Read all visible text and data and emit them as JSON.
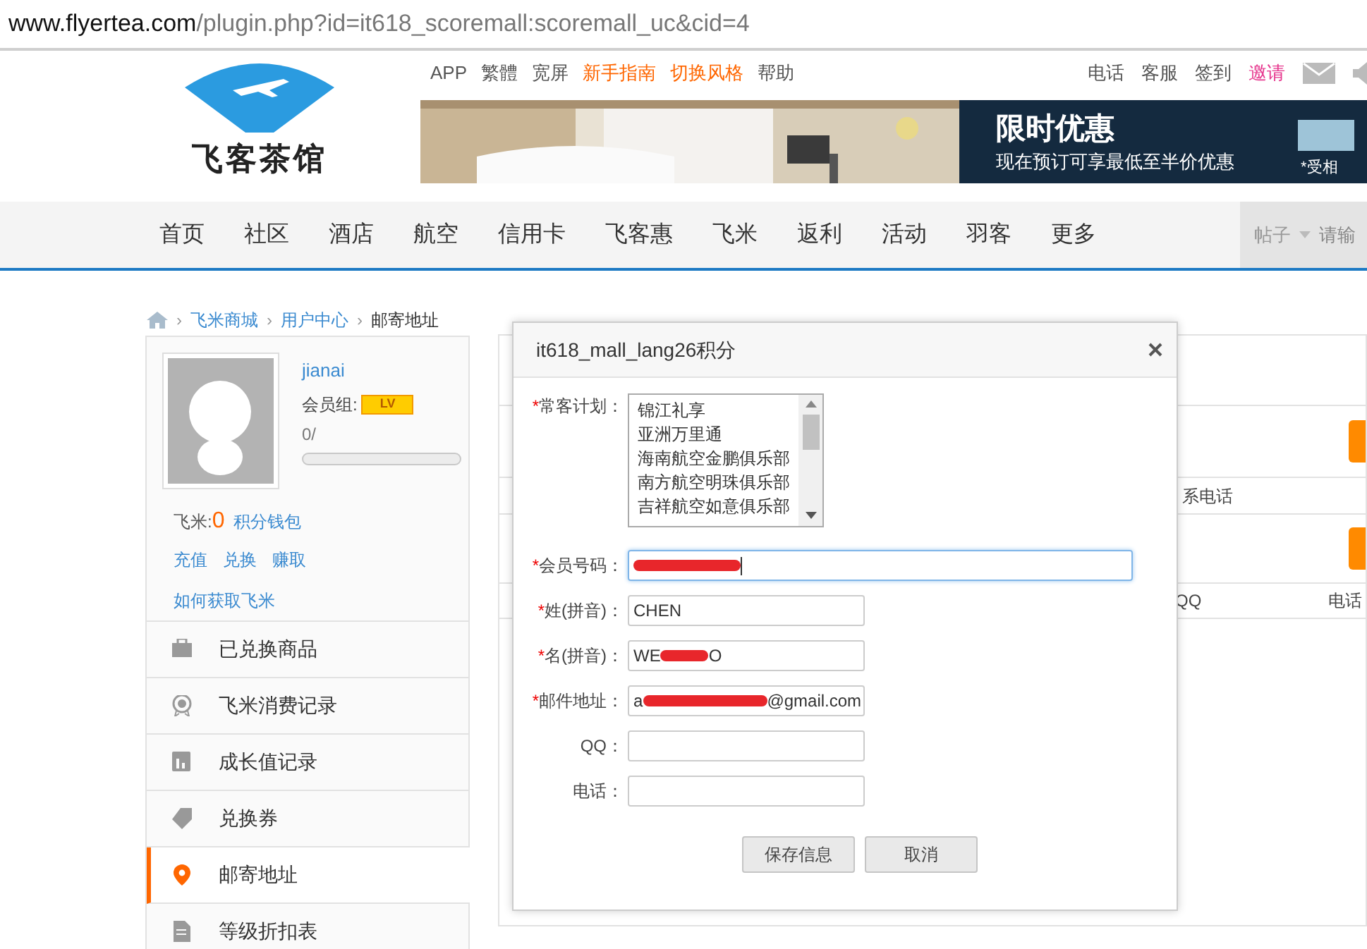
{
  "address_bar": {
    "host": "www.flyertea.com",
    "path": "/plugin.php?id=it618_scoremall:scoremall_uc&cid=4"
  },
  "logo": {
    "text": "飞客茶馆"
  },
  "top_links": [
    {
      "label": "APP",
      "highlight": false
    },
    {
      "label": "繁體",
      "highlight": false
    },
    {
      "label": "宽屏",
      "highlight": false
    },
    {
      "label": "新手指南",
      "highlight": true
    },
    {
      "label": "切换风格",
      "highlight": true
    },
    {
      "label": "帮助",
      "highlight": false
    }
  ],
  "user_links": [
    {
      "label": "电话",
      "highlight": false
    },
    {
      "label": "客服",
      "highlight": false
    },
    {
      "label": "签到",
      "highlight": false
    },
    {
      "label": "邀请",
      "highlight": true
    }
  ],
  "banner": {
    "title": "限时优惠",
    "subtitle": "现在预订可享最低至半价优惠",
    "note": "*受相"
  },
  "nav": [
    "首页",
    "社区",
    "酒店",
    "航空",
    "信用卡",
    "飞客惠",
    "飞米",
    "返利",
    "活动",
    "羽客",
    "更多"
  ],
  "search": {
    "scope": "帖子",
    "placeholder": "请输"
  },
  "breadcrumb": [
    "飞米商城",
    "用户中心",
    "邮寄地址"
  ],
  "breadcrumb_separator": "›",
  "profile": {
    "username": "jianai",
    "group_label": "会员组:",
    "badge": "LV",
    "progress_text": "0/",
    "level": 0,
    "coins_label": "飞米:",
    "coins": "0",
    "wallet": "积分钱包",
    "actions": [
      "充值",
      "兑换",
      "赚取"
    ],
    "how_to": "如何获取飞米"
  },
  "menu": [
    {
      "label": "已兑换商品",
      "selected": false
    },
    {
      "label": "飞米消费记录",
      "selected": false
    },
    {
      "label": "成长值记录",
      "selected": false
    },
    {
      "label": "兑换券",
      "selected": false
    },
    {
      "label": "邮寄地址",
      "selected": true
    },
    {
      "label": "等级折扣表",
      "selected": false
    }
  ],
  "background_table": {
    "header_1": "系电话",
    "header_2_col_1": "QQ",
    "header_2_col_2": "电话"
  },
  "dialog": {
    "title": "it618_mall_lang26积分",
    "required_mark": "*",
    "program_label": "常客计划：",
    "programs": [
      "锦江礼享",
      "亚洲万里通",
      "海南航空金鹏俱乐部",
      "南方航空明珠俱乐部",
      "吉祥航空如意俱乐部"
    ],
    "fields": [
      {
        "label": "会员号码：",
        "required": true,
        "wide": true,
        "focused": true,
        "redacted": true
      },
      {
        "label": "姓(拼音)：",
        "required": true,
        "wide": false,
        "focused": false,
        "value": "CHEN",
        "redacted": false
      },
      {
        "label": "名(拼音)：",
        "required": true,
        "wide": false,
        "focused": false,
        "value": "WE",
        "value_end": "O",
        "redacted": true
      },
      {
        "label": "邮件地址：",
        "required": true,
        "wide": false,
        "focused": false,
        "value": "a",
        "value_end": "@gmail.com",
        "redacted": true
      },
      {
        "label": "QQ：",
        "required": false,
        "wide": false,
        "focused": false,
        "redacted": false
      },
      {
        "label": "电话：",
        "required": false,
        "wide": false,
        "focused": false,
        "redacted": false
      }
    ],
    "buttons": [
      "保存信息",
      "取消"
    ]
  }
}
